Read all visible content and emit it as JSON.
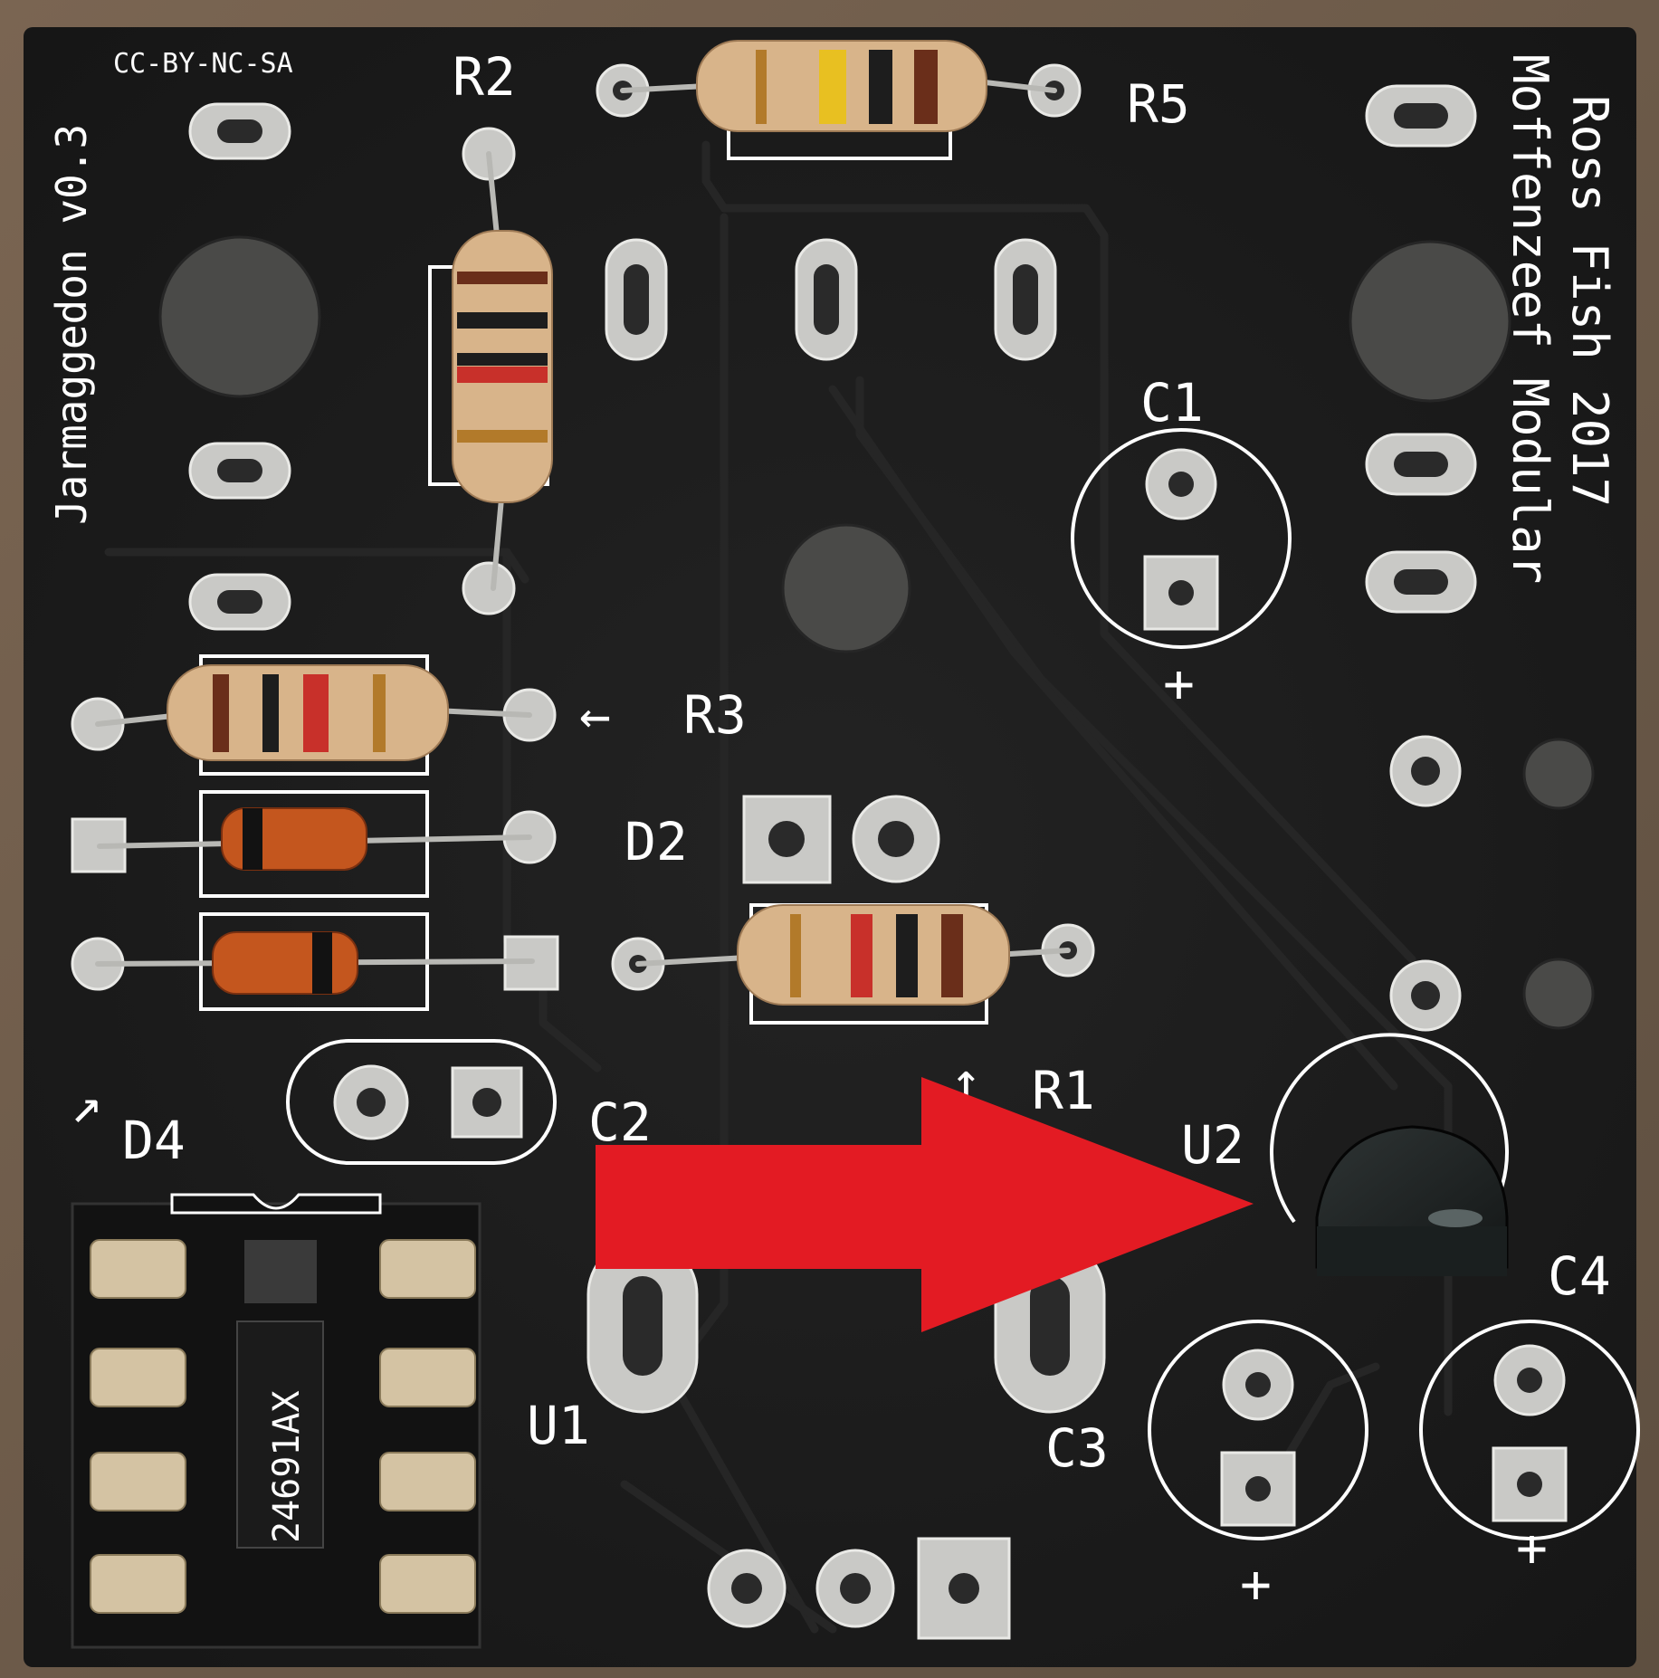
{
  "board": {
    "color": "#1c1c1c",
    "silkscreen_color": "#ffffff",
    "license": "CC-BY-NC-SA",
    "project_name": "Jarmaggedon v0.3",
    "author": "Ross Fish 2017",
    "company": "Moffenzeef Modular"
  },
  "labels": {
    "r1": "R1",
    "r2": "R2",
    "r3": "R3",
    "r5": "R5",
    "c1": "C1",
    "c2": "C2",
    "c3": "C3",
    "c4": "C4",
    "d2": "D2",
    "d4": "D4",
    "u1": "U1",
    "u2": "U2",
    "plus_c1": "+",
    "plus_c3": "+",
    "plus_c4": "+",
    "r3_arrow": "←",
    "r1_arrow": "↑",
    "d4_arrow": "↗"
  },
  "ic": {
    "marking": "24691AX"
  },
  "annotation": {
    "arrow_color": "#e31b23",
    "points_to": "U2"
  }
}
